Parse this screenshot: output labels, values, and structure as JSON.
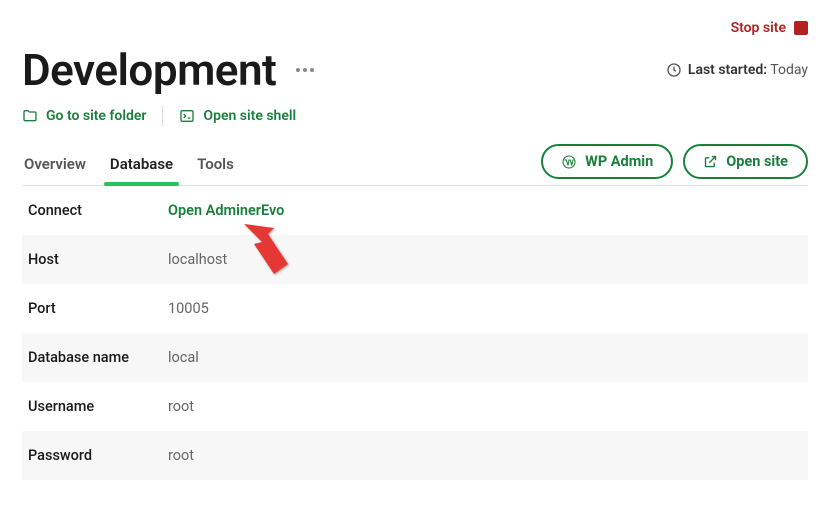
{
  "stop_site_label": "Stop site",
  "site_title": "Development",
  "last_started_label": "Last started:",
  "last_started_value": "Today",
  "quick_links": {
    "folder": "Go to site folder",
    "shell": "Open site shell"
  },
  "tabs": {
    "overview": "Overview",
    "database": "Database",
    "tools": "Tools"
  },
  "buttons": {
    "wp_admin": "WP Admin",
    "open_site": "Open site"
  },
  "rows": {
    "connect": {
      "label": "Connect",
      "value": "Open AdminerEvo"
    },
    "host": {
      "label": "Host",
      "value": "localhost"
    },
    "port": {
      "label": "Port",
      "value": "10005"
    },
    "dbname": {
      "label": "Database name",
      "value": "local"
    },
    "user": {
      "label": "Username",
      "value": "root"
    },
    "pass": {
      "label": "Password",
      "value": "root"
    }
  }
}
